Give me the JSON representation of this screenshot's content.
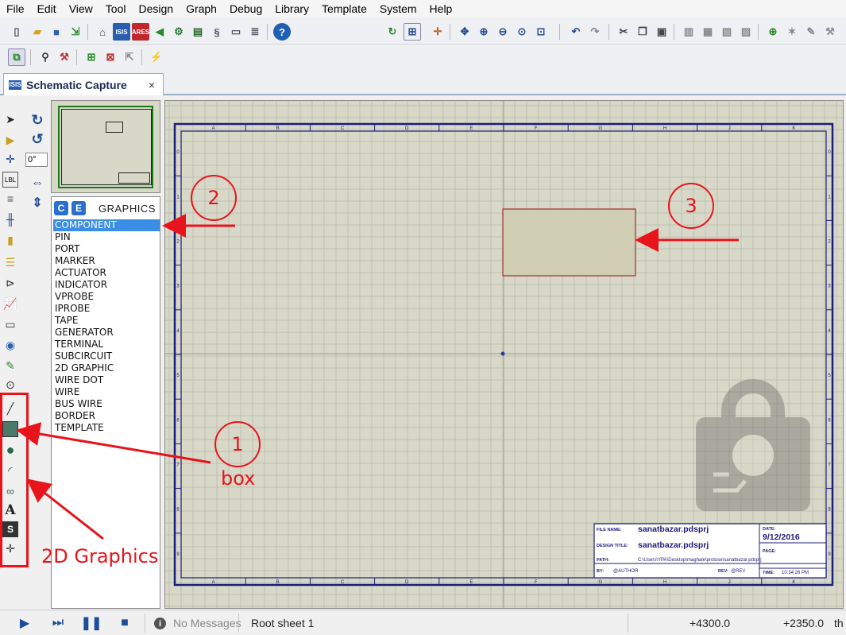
{
  "menubar": {
    "items": [
      "File",
      "Edit",
      "View",
      "Tool",
      "Design",
      "Graph",
      "Debug",
      "Library",
      "Template",
      "System",
      "Help"
    ]
  },
  "tab": {
    "icon": "ISIS",
    "label": "Schematic Capture",
    "close": "×"
  },
  "rotation": {
    "angle": "0°"
  },
  "component_list": {
    "btn_c": "C",
    "btn_e": "E",
    "title": "GRAPHICS",
    "items": [
      "COMPONENT",
      "PIN",
      "PORT",
      "MARKER",
      "ACTUATOR",
      "INDICATOR",
      "VPROBE",
      "IPROBE",
      "TAPE",
      "GENERATOR",
      "TERMINAL",
      "SUBCIRCUIT",
      "2D GRAPHIC",
      "WIRE DOT",
      "WIRE",
      "BUS WIRE",
      "BORDER",
      "TEMPLATE"
    ],
    "selected": "COMPONENT"
  },
  "sheet": {
    "col_labels": [
      "A",
      "B",
      "C",
      "D",
      "E",
      "F",
      "G",
      "H",
      "J",
      "K"
    ],
    "row_labels": [
      "0",
      "1",
      "2",
      "3",
      "4",
      "5",
      "6",
      "7",
      "8",
      "9"
    ],
    "title_block": {
      "file_name_label": "FILE NAME:",
      "file_name": "sanatbazar.pdsprj",
      "design_title_label": "DESIGN TITLE:",
      "design_title": "sanatbazar.pdsprj",
      "path_label": "PATH:",
      "path": "C:\\Users\\YPA\\Desktop\\maghale\\protuse\\sanatbazar.pdsprj",
      "by_label": "BY:",
      "by": "@AUTHOR",
      "rev_label": "REV:",
      "rev": "@REV",
      "date_label": "DATE:",
      "date": "9/12/2016",
      "page_label": "PAGE:",
      "time_label": "TIME:",
      "time": "10:34:26 PM"
    }
  },
  "annotations": {
    "n1": "1",
    "n2": "2",
    "n3": "3",
    "box": "box",
    "graphics2d": "2D Graphics"
  },
  "statusbar": {
    "messages": "No Messages",
    "sheet": "Root sheet 1",
    "x": "+4300.0",
    "y": "+2350.0",
    "unit": "th"
  },
  "colors": {
    "annotation": "#e8141b",
    "sheet_border": "#1c1c7c",
    "grid": "#b8b8a8",
    "canvas": "#d8d8c8",
    "box_fill": "#cfcdb2",
    "box_stroke": "#a03030"
  }
}
